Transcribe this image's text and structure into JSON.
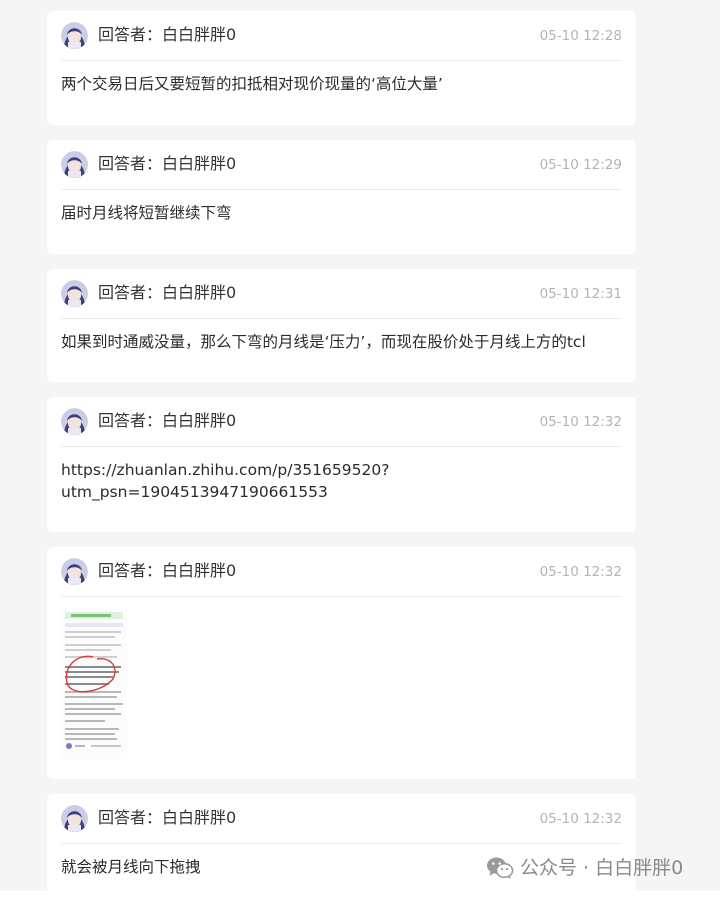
{
  "answers": [
    {
      "author": "回答者：白白胖胖0",
      "time": "05-10 12:28",
      "text": "两个交易日后又要短暂的扣抵相对现价现量的‘高位大量’"
    },
    {
      "author": "回答者：白白胖胖0",
      "time": "05-10 12:29",
      "text": "届时月线将短暂继续下弯"
    },
    {
      "author": "回答者：白白胖胖0",
      "time": "05-10 12:31",
      "text": "如果到时通威没量，那么下弯的月线是‘压力’，而现在股价处于月线上方的tcl"
    },
    {
      "author": "回答者：白白胖胖0",
      "time": "05-10 12:32",
      "text": "https://zhuanlan.zhihu.com/p/351659520?utm_psn=1904513947190661553"
    },
    {
      "author": "回答者：白白胖胖0",
      "time": "05-10 12:32",
      "image": "screenshot-thumbnail"
    },
    {
      "author": "回答者：白白胖胖0",
      "time": "05-10 12:32",
      "text": "就会被月线向下拖拽"
    }
  ],
  "footer": {
    "text": "公众号 · 白白胖胖0",
    "icon": "wechat-icon"
  },
  "colors": {
    "background": "#f5f5f6",
    "card": "#ffffff",
    "time": "#b3b3b3",
    "footer": "#8a8a8a"
  }
}
